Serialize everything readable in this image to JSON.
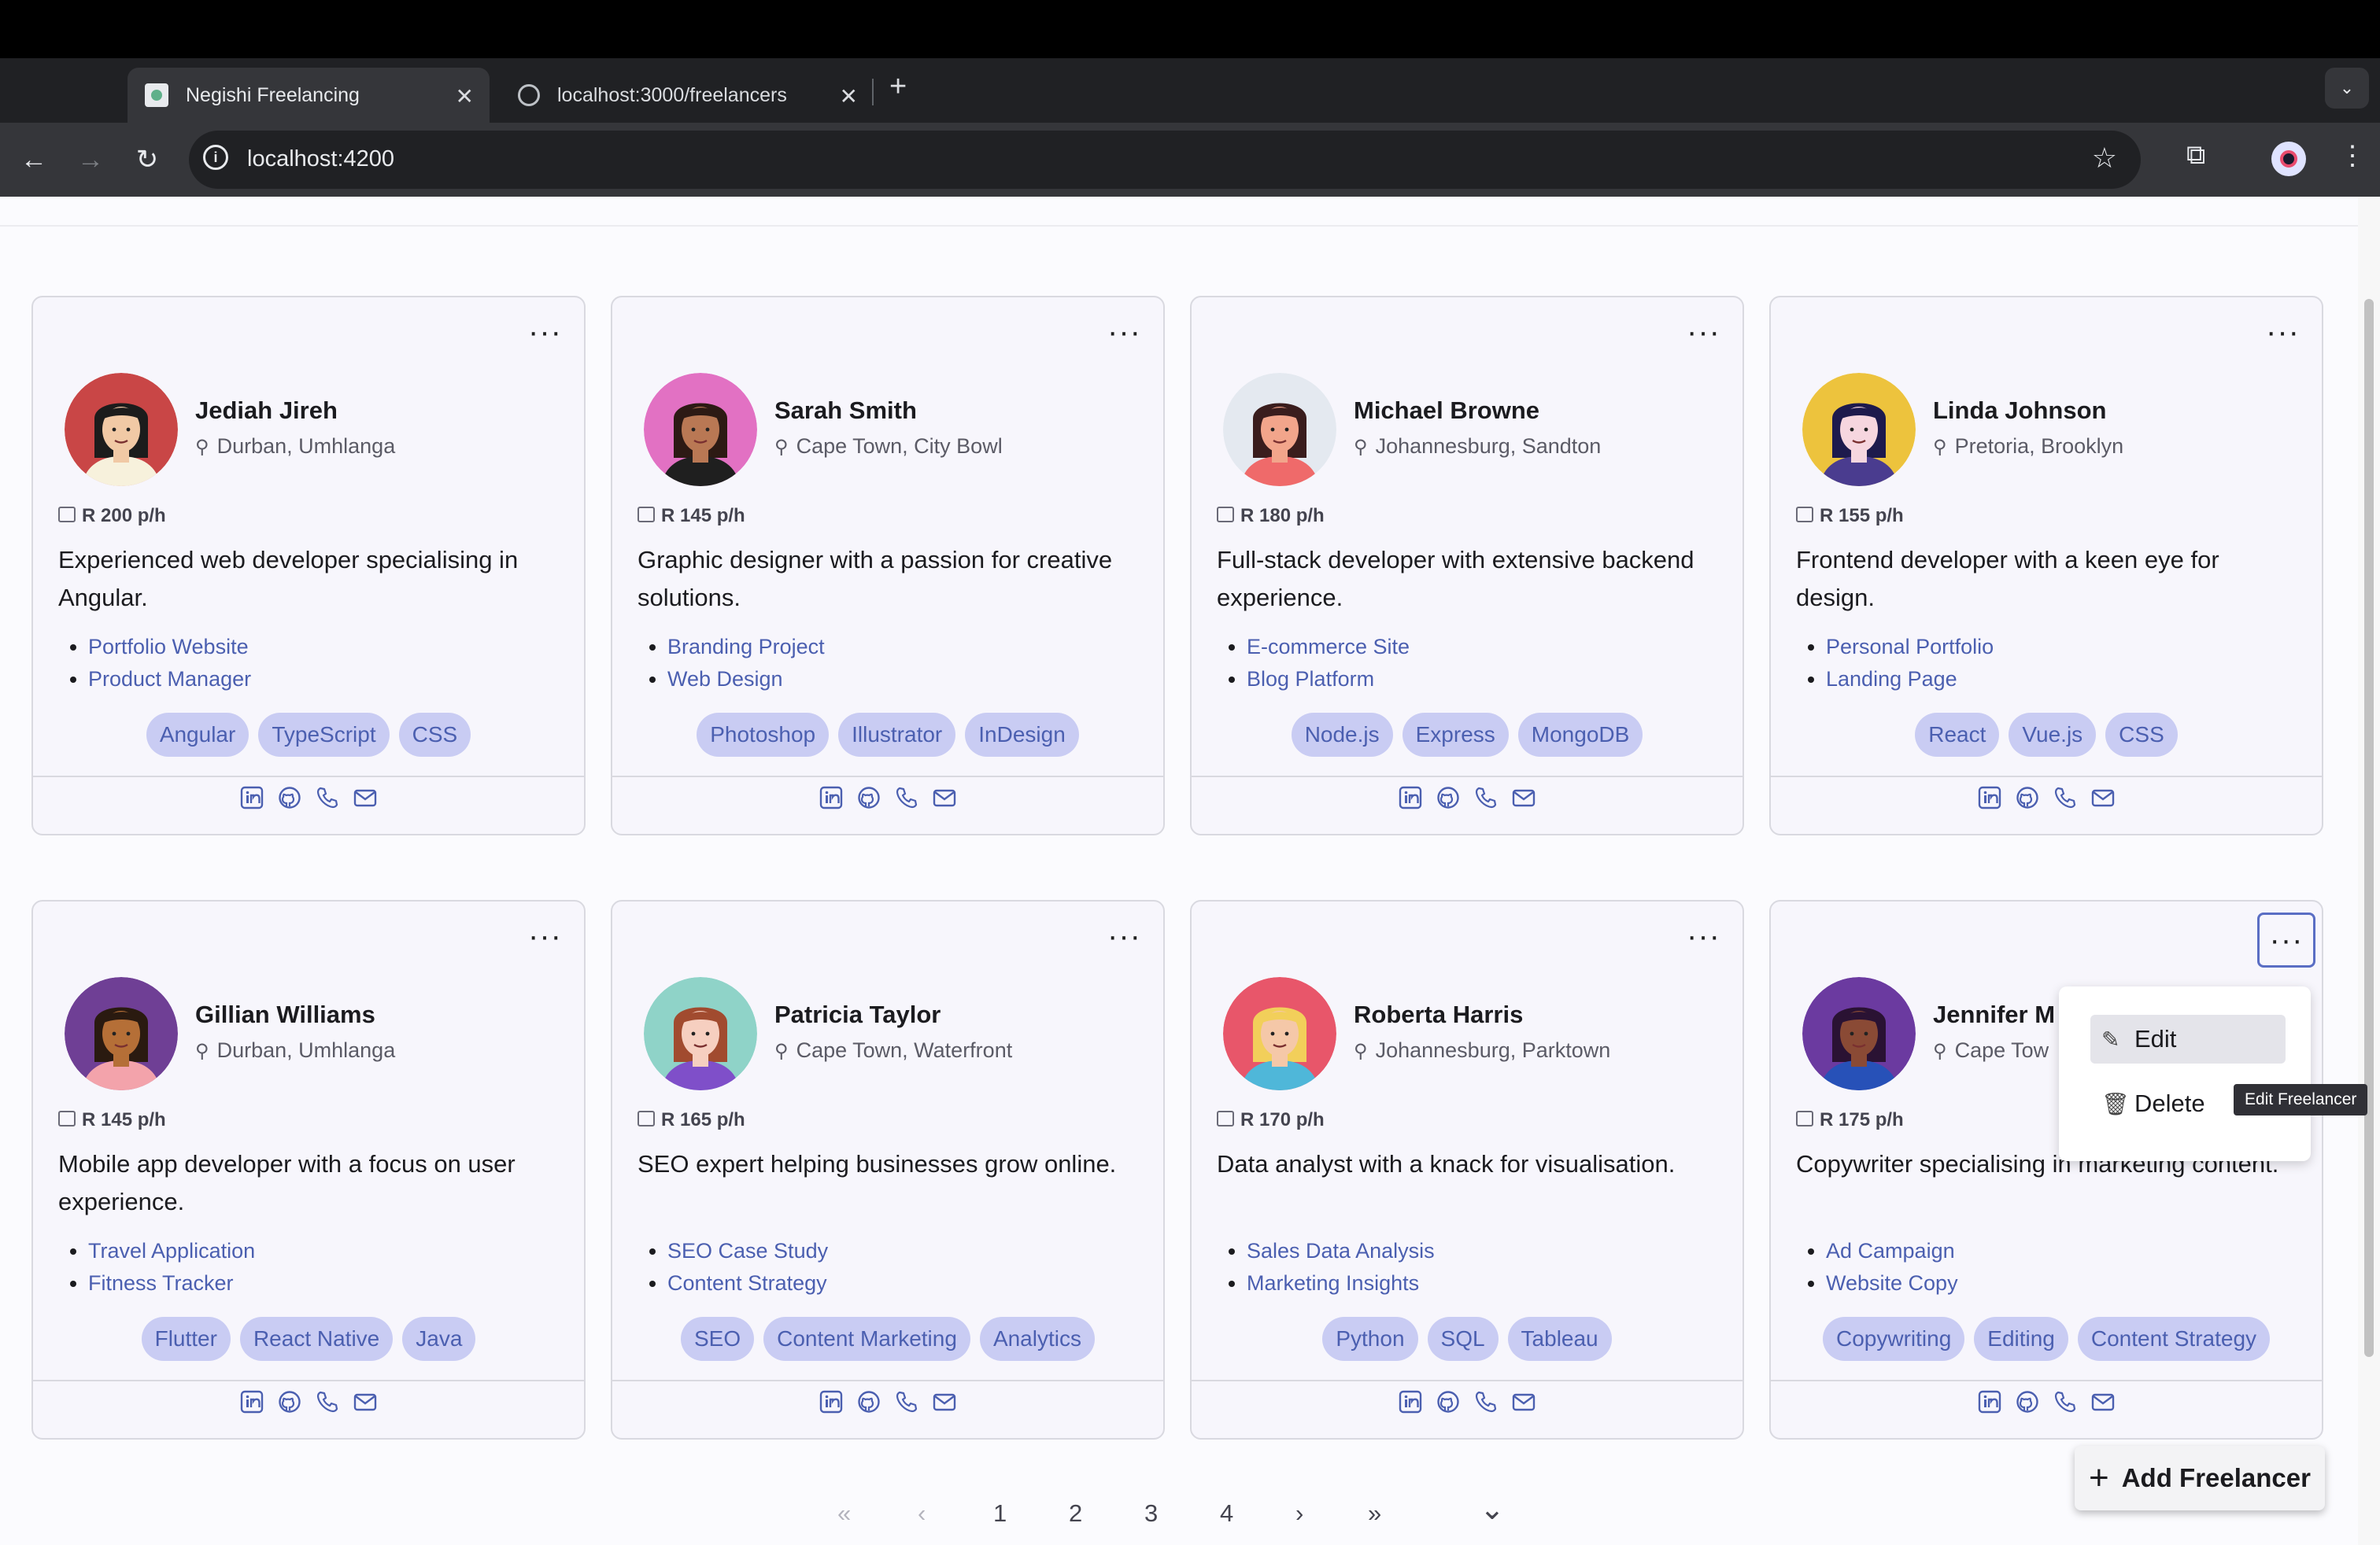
{
  "browser": {
    "tabs": [
      {
        "title": "Negishi Freelancing",
        "active": true
      },
      {
        "title": "localhost:3000/freelancers",
        "active": false
      }
    ],
    "url": "localhost:4200"
  },
  "freelancers": [
    {
      "name": "Jediah Jireh",
      "location": "Durban, Umhlanga",
      "rate": "R 200 p/h",
      "description": "Experienced web developer specialising in Angular.",
      "projects": [
        "Portfolio Website",
        "Product Manager"
      ],
      "skills": [
        "Angular",
        "TypeScript",
        "CSS"
      ],
      "avatar": {
        "bg": "#c94646",
        "skin": "#f1c9a5",
        "hair": "#1c1c1c",
        "shirt": "#f7f1dc"
      }
    },
    {
      "name": "Sarah Smith",
      "location": "Cape Town, City Bowl",
      "rate": "R 145 p/h",
      "description": "Graphic designer with a passion for creative solutions.",
      "projects": [
        "Branding Project",
        "Web Design"
      ],
      "skills": [
        "Photoshop",
        "Illustrator",
        "InDesign"
      ],
      "avatar": {
        "bg": "#e271c3",
        "skin": "#b97854",
        "hair": "#2d1a14",
        "shirt": "#1f1f1f"
      }
    },
    {
      "name": "Michael Browne",
      "location": "Johannesburg, Sandton",
      "rate": "R 180 p/h",
      "description": "Full-stack developer with extensive backend experience.",
      "projects": [
        "E-commerce Site",
        "Blog Platform"
      ],
      "skills": [
        "Node.js",
        "Express",
        "MongoDB"
      ],
      "avatar": {
        "bg": "#e4e9f0",
        "skin": "#f2a58b",
        "hair": "#3a1d1d",
        "shirt": "#ef6a6a"
      }
    },
    {
      "name": "Linda Johnson",
      "location": "Pretoria, Brooklyn",
      "rate": "R 155 p/h",
      "description": "Frontend developer with a keen eye for design.",
      "projects": [
        "Personal Portfolio",
        "Landing Page"
      ],
      "skills": [
        "React",
        "Vue.js",
        "CSS"
      ],
      "avatar": {
        "bg": "#edc33d",
        "skin": "#f6d6df",
        "hair": "#1d1a4d",
        "shirt": "#4a3c8f"
      }
    },
    {
      "name": "Gillian Williams",
      "location": "Durban, Umhlanga",
      "rate": "R 145 p/h",
      "description": "Mobile app developer with a focus on user experience.",
      "projects": [
        "Travel Application",
        "Fitness Tracker"
      ],
      "skills": [
        "Flutter",
        "React Native",
        "Java"
      ],
      "avatar": {
        "bg": "#6f3f95",
        "skin": "#b56f37",
        "hair": "#2a1a10",
        "shirt": "#f3a3ab"
      }
    },
    {
      "name": "Patricia Taylor",
      "location": "Cape Town, Waterfront",
      "rate": "R 165 p/h",
      "description": "SEO expert helping businesses grow online.",
      "projects": [
        "SEO Case Study",
        "Content Strategy"
      ],
      "skills": [
        "SEO",
        "Content Marketing",
        "Analytics"
      ],
      "avatar": {
        "bg": "#8fd3c8",
        "skin": "#f6cfc0",
        "hair": "#a14b2f",
        "shirt": "#7f4fc9"
      }
    },
    {
      "name": "Roberta Harris",
      "location": "Johannesburg, Parktown",
      "rate": "R 170 p/h",
      "description": "Data analyst with a knack for visualisation.",
      "projects": [
        "Sales Data Analysis",
        "Marketing Insights"
      ],
      "skills": [
        "Python",
        "SQL",
        "Tableau"
      ],
      "avatar": {
        "bg": "#e8566a",
        "skin": "#f5c8a8",
        "hair": "#f2cf5a",
        "shirt": "#4fb7d9"
      }
    },
    {
      "name": "Jennifer M",
      "location": "Cape Tow",
      "rate": "R 175 p/h",
      "description": "Copywriter specialising in marketing content.",
      "projects": [
        "Ad Campaign",
        "Website Copy"
      ],
      "skills": [
        "Copywriting",
        "Editing",
        "Content Strategy"
      ],
      "avatar": {
        "bg": "#6b3aa0",
        "skin": "#8a4a35",
        "hair": "#2a1233",
        "shirt": "#2751b8"
      }
    }
  ],
  "menu": {
    "edit": "Edit",
    "delete": "Delete",
    "tooltip": "Edit Freelancer"
  },
  "fab_label": "Add Freelancer",
  "pagination": {
    "first": "«",
    "prev": "‹",
    "pages": [
      "1",
      "2",
      "3",
      "4"
    ],
    "next": "›",
    "last": "»",
    "toggle": "⌄"
  },
  "contact_icons": [
    "linkedin-icon",
    "github-icon",
    "phone-icon",
    "mail-icon"
  ],
  "colors": {
    "accent": "#4b5fb0",
    "tag_bg": "#c9ccf3",
    "card_bg": "#f7f6fc"
  }
}
